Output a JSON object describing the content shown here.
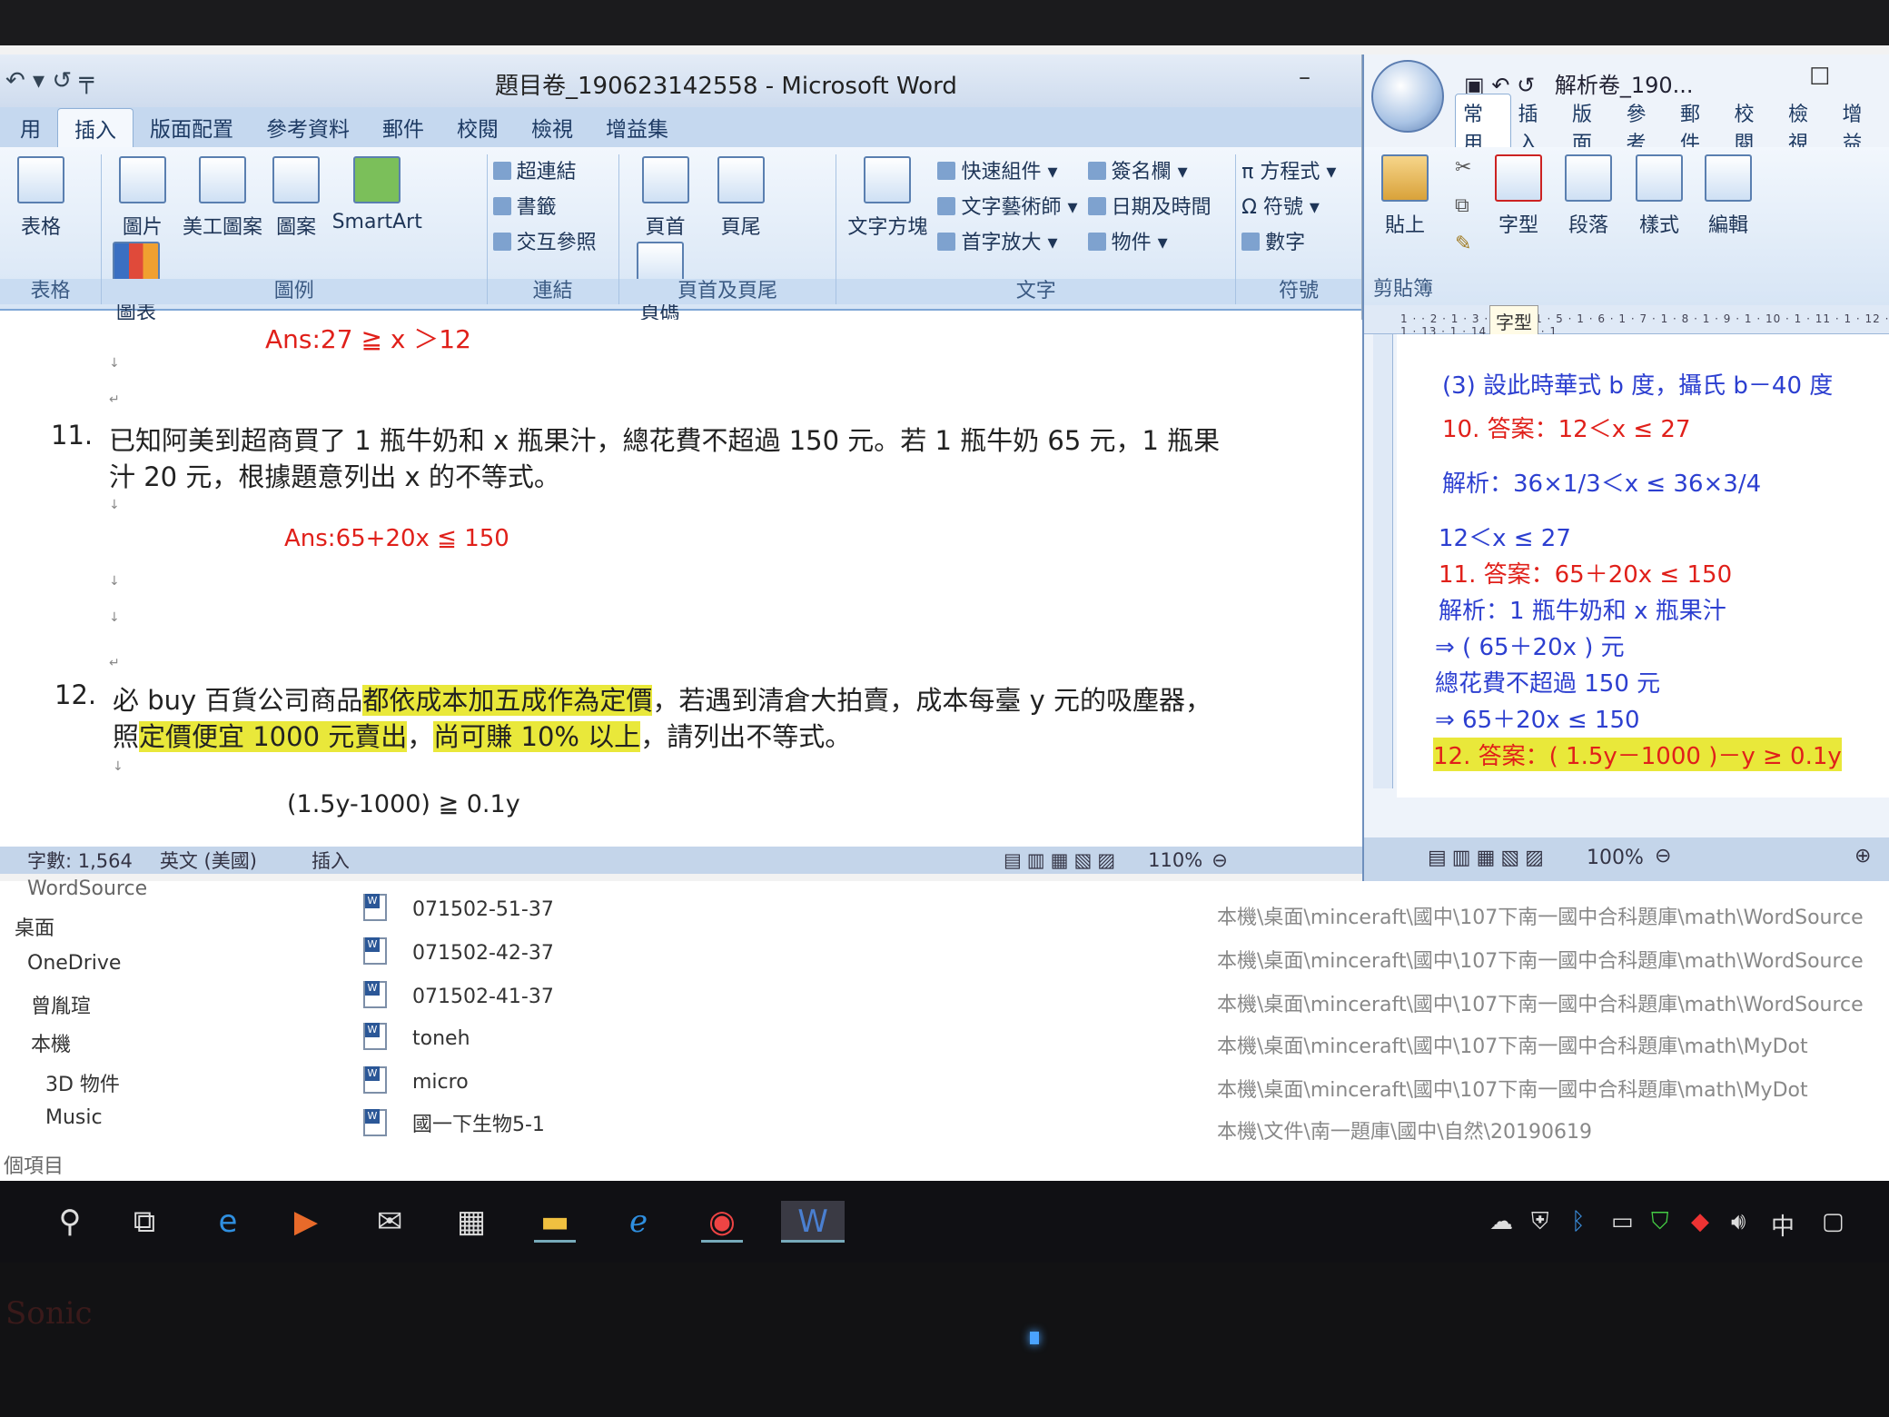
{
  "wordA": {
    "title": "題目卷_190623142558 - Microsoft Word",
    "quick_access": "↶ ▾ ↺ ╤",
    "tabs": [
      "用",
      "插入",
      "版面配置",
      "參考資料",
      "郵件",
      "校閱",
      "檢視",
      "增益集"
    ],
    "groups": {
      "table": {
        "label": "表格",
        "items": [
          "表格"
        ]
      },
      "illustrations": {
        "label": "圖例",
        "items": [
          "圖片",
          "美工圖案",
          "圖案",
          "SmartArt",
          "圖表"
        ]
      },
      "links": {
        "label": "連結",
        "items": [
          "超連結",
          "書籤",
          "交互參照"
        ]
      },
      "header_footer": {
        "label": "頁首及頁尾",
        "items": [
          "頁首",
          "頁尾",
          "頁碼"
        ]
      },
      "text": {
        "label": "文字",
        "items": [
          "文字方塊",
          "快速組件 ▾",
          "文字藝術師 ▾",
          "首字放大 ▾",
          "簽名欄 ▾",
          "日期及時間",
          "物件 ▾"
        ]
      },
      "symbols": {
        "label": "符號",
        "items": [
          "π 方程式 ▾",
          "Ω 符號 ▾",
          "數字"
        ]
      }
    },
    "doc": {
      "ans10": "Ans:27 ≧ x ＞12",
      "q11_num": "11.",
      "q11_line1": "已知阿美到超商買了 1 瓶牛奶和 x 瓶果汁，總花費不超過 150 元。若 1 瓶牛奶 65 元，1 瓶果",
      "q11_line2": "汁 20 元，根據題意列出 x 的不等式。",
      "ans11": "Ans:65+20x ≦ 150",
      "q12_num": "12.",
      "q12_a": "必 buy 百貨公司商品",
      "q12_b": "都依成本加五成作為定價",
      "q12_c": "，若遇到清倉大拍賣，成本每臺 y 元的吸塵器，",
      "q12_d": "照",
      "q12_e": "定價便宜 1000 元賣出",
      "q12_f": "，",
      "q12_g": "尚可賺 10% 以上",
      "q12_h": "，請列出不等式。",
      "ans12": "(1.5y-1000) ≧ 0.1y"
    },
    "status": {
      "words": "字數: 1,564",
      "lang": "英文 (美國)",
      "mode": "插入",
      "zoom": "110%"
    }
  },
  "wordB": {
    "title": "解析卷_190...",
    "tabs": [
      "常用",
      "插入",
      "版面",
      "參考",
      "郵件",
      "校閱",
      "檢視",
      "增益"
    ],
    "buttons": [
      "貼上",
      "字型",
      "段落",
      "樣式",
      "編輯"
    ],
    "clipboard": "剪貼簿",
    "tooltip": "字型",
    "ruler": "1 · · 2 · 1 · 3 · 1 · 4 · 1 · 5 · 1 · 6 · 1 · 7 · 1 · 8 · 1 · 9 · 1 · 10 · 1 · 11 · 1 · 12 · 1 · 13 · 1 · 14 · 1 · 15 · 1",
    "lines": [
      "(3) 設此時華式 b 度，攝氏 b－40 度",
      "10. 答案：12＜x ≤ 27",
      "解析：36×1/3＜x ≤ 36×3/4",
      "12＜x ≤ 27",
      "11. 答案：65＋20x ≤ 150",
      "解析：1 瓶牛奶和 x 瓶果汁",
      "⇒ ( 65＋20x ) 元",
      "總花費不超過 150 元",
      "⇒ 65＋20x ≤ 150",
      "12. 答案：( 1.5y－1000 )－y ≥ 0.1y"
    ],
    "zoom": "100%"
  },
  "explorer": {
    "nav": [
      "WordSource",
      "桌面",
      "OneDrive",
      "曾胤瑄",
      "本機",
      "3D 物件",
      "Music"
    ],
    "footer": "個項目",
    "files": [
      {
        "name": "071502-51-37",
        "path": "本機\\桌面\\minceraft\\國中\\107下南一國中合科題庫\\math\\WordSource"
      },
      {
        "name": "071502-42-37",
        "path": "本機\\桌面\\minceraft\\國中\\107下南一國中合科題庫\\math\\WordSource"
      },
      {
        "name": "071502-41-37",
        "path": "本機\\桌面\\minceraft\\國中\\107下南一國中合科題庫\\math\\WordSource"
      },
      {
        "name": "toneh",
        "path": "本機\\桌面\\minceraft\\國中\\107下南一國中合科題庫\\math\\MyDot"
      },
      {
        "name": "micro",
        "path": "本機\\桌面\\minceraft\\國中\\107下南一國中合科題庫\\math\\MyDot"
      },
      {
        "name": "國一下生物5-1",
        "path": "本機\\文件\\南一題庫\\國中\\自然\\20190619"
      }
    ]
  },
  "taskbar": {
    "ime": "中"
  },
  "monitor": {
    "brand": "Sonic"
  }
}
